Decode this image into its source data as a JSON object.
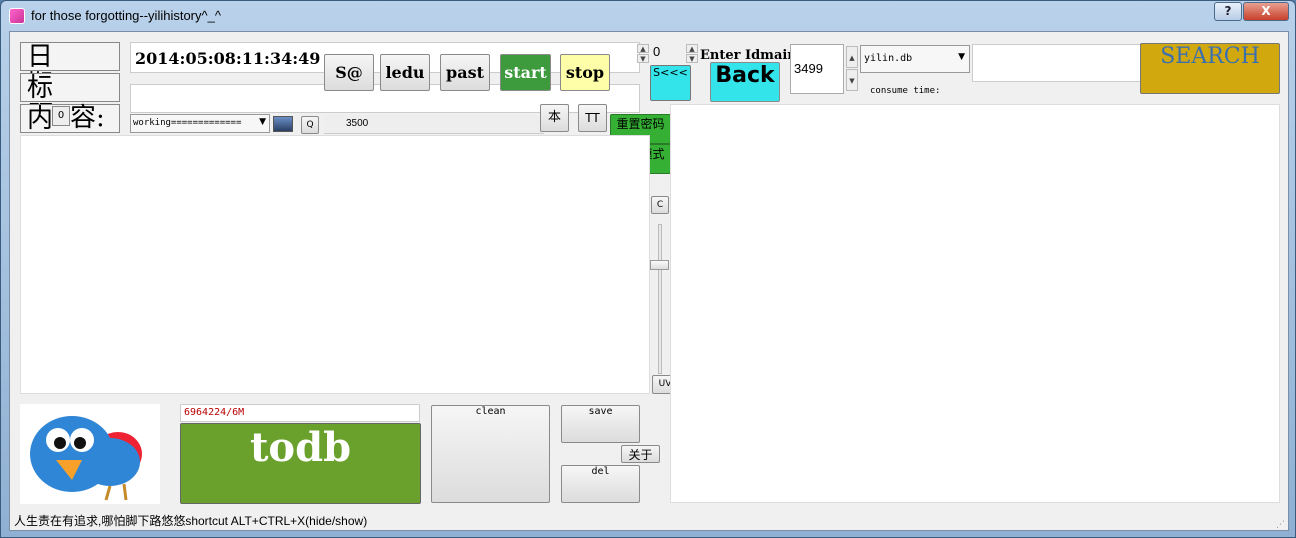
{
  "window": {
    "title": "for those forgotting--yilihistory^_^",
    "help_label": "?",
    "close_label": "X"
  },
  "labels": {
    "date": "日 期:",
    "title": "标 题:",
    "content_left": "内",
    "content_small": "0",
    "content_right": "容:"
  },
  "date_value": "2014:05:08:11:34:49",
  "buttons": {
    "s_at": "S@",
    "ledu": "ledu",
    "past": "past",
    "start": "start",
    "stop": "stop",
    "s_back": "S<<<",
    "back": "Back",
    "search": "SEARCH",
    "q": "Q",
    "ben": "本",
    "tt": "TT",
    "reset_password": "重置密码",
    "reading_mode": "阅读模式",
    "c": "C",
    "uv": "UV",
    "todb": "todb",
    "clean": "clean",
    "save": "save",
    "about": "关于",
    "del": "del"
  },
  "spin_value": "0",
  "enter_idmain_label": "Enter Idmain:",
  "idmain_value": "3499",
  "db_select": "yilin.db",
  "consume_label": "consume time:",
  "working_select": "working=============",
  "count_3500": "3500",
  "size_label": "6964224/6M",
  "status_text": "人生责在有追求,哪怕脚下路悠悠shortcut ALT+CTRL+X(hide/show)",
  "colors": {
    "start_bg": "#3d9a3d",
    "stop_bg": "#fefea8",
    "back_bg": "#33e4ea",
    "search_bg": "#d2a80f",
    "search_text": "#3a6fb0",
    "todb_bg": "#6aa12c",
    "green_btn": "#35b035"
  },
  "icons": [
    "app-icon",
    "bird-logo-icon",
    "image-thumb-icon"
  ]
}
